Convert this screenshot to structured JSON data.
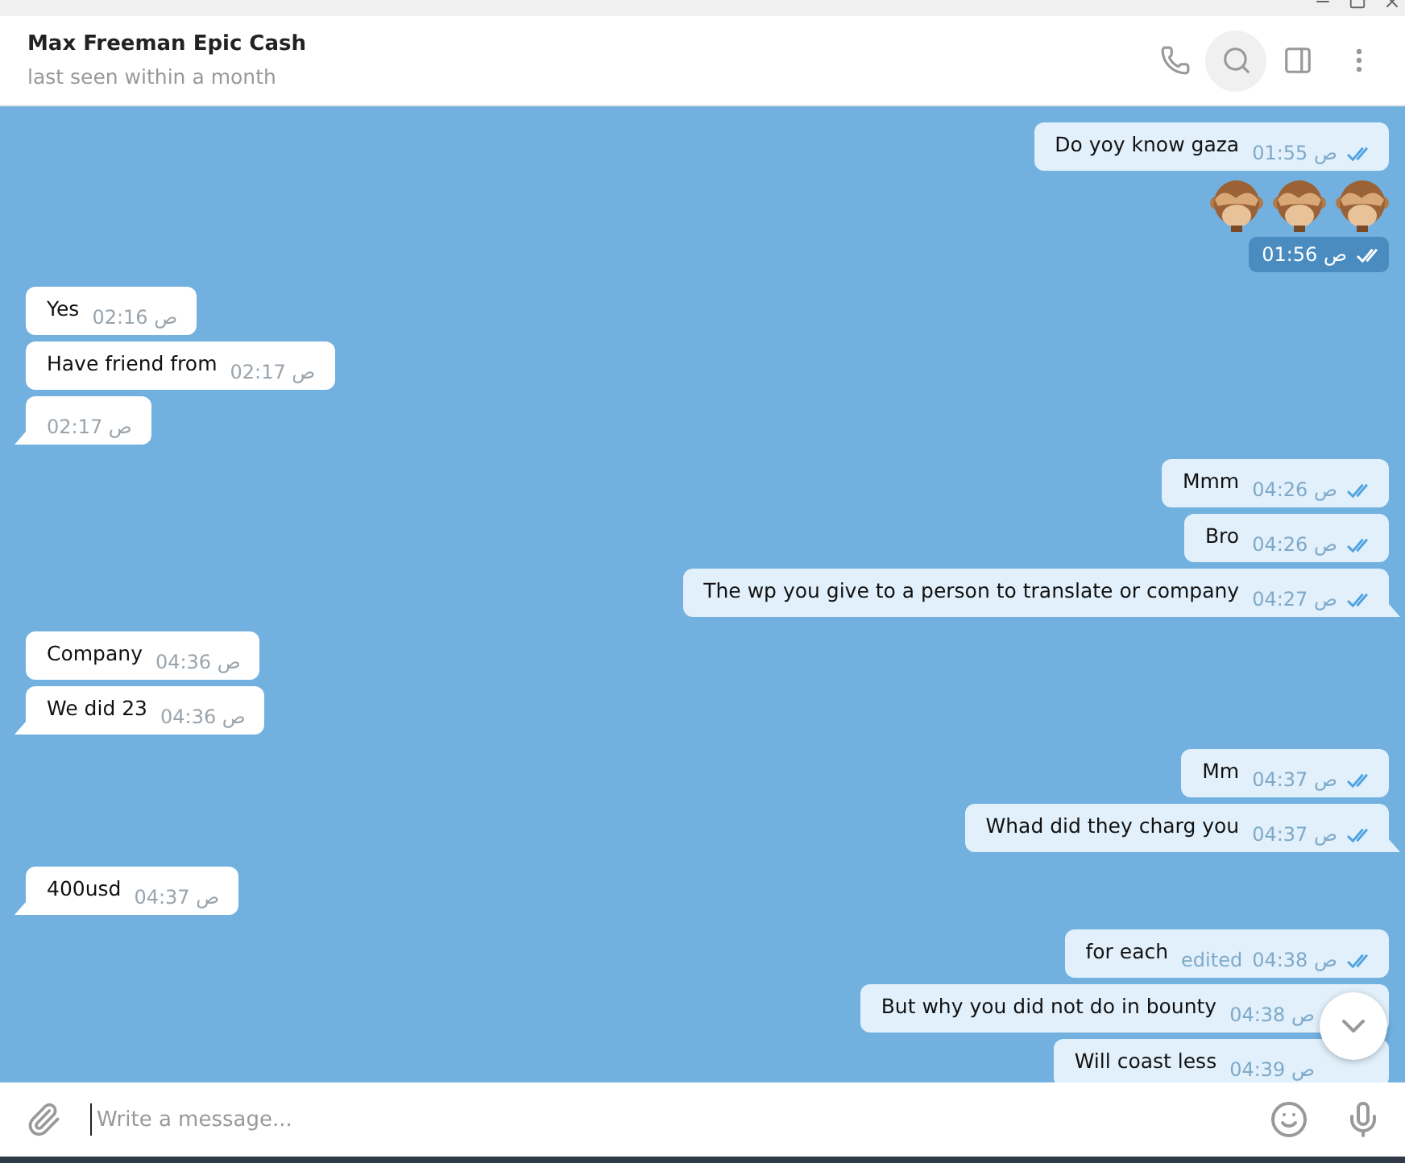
{
  "chat": {
    "title": "Max Freeman Epic Cash",
    "status": "last seen within a month"
  },
  "messages": [
    {
      "kind": "text",
      "outgoing": true,
      "text": "Do yoy know gaza",
      "time": "01:55 ص",
      "read": true
    },
    {
      "kind": "emoji",
      "outgoing": true,
      "emojis": [
        {
          "kind": "see-no-evil-monkey"
        },
        {
          "kind": "see-no-evil-monkey"
        },
        {
          "kind": "see-no-evil-monkey"
        }
      ],
      "time": "01:56 ص",
      "read": true
    },
    {
      "kind": "text",
      "outgoing": false,
      "text": "Yes",
      "time": "02:16 ص",
      "tail": false
    },
    {
      "kind": "text",
      "outgoing": false,
      "text": "Have friend from",
      "time": "02:17 ص",
      "tail": false
    },
    {
      "kind": "text",
      "outgoing": false,
      "time": "02:17 ص",
      "tail": true
    },
    {
      "kind": "text",
      "outgoing": true,
      "text": "Mmm",
      "time": "04:26 ص",
      "read": true,
      "tail": false
    },
    {
      "kind": "text",
      "outgoing": true,
      "text": "Bro",
      "time": "04:26 ص",
      "read": true,
      "tail": false
    },
    {
      "kind": "text",
      "outgoing": true,
      "text": "The wp you give to a person to translate or company",
      "time": "04:27 ص",
      "read": true,
      "tail": true
    },
    {
      "kind": "text",
      "outgoing": false,
      "text": "Company",
      "time": "04:36 ص",
      "tail": false
    },
    {
      "kind": "text",
      "outgoing": false,
      "text": "We did 23",
      "time": "04:36 ص",
      "tail": true
    },
    {
      "kind": "text",
      "outgoing": true,
      "text": "Mm",
      "time": "04:37 ص",
      "read": true,
      "tail": false
    },
    {
      "kind": "text",
      "outgoing": true,
      "text": "Whad did they charg you",
      "time": "04:37 ص",
      "read": true,
      "tail": true
    },
    {
      "kind": "text",
      "outgoing": false,
      "text": "400usd",
      "time": "04:37 ص",
      "tail": true
    },
    {
      "kind": "text",
      "outgoing": true,
      "text": "for each",
      "edited": "edited",
      "time": "04:38 ص",
      "read": true
    },
    {
      "kind": "text",
      "outgoing": true,
      "text": "But why you did not do in bounty",
      "time": "04:38 ص",
      "covered": true
    },
    {
      "kind": "text",
      "outgoing": true,
      "text": "Will coast less",
      "time": "04:39 ص",
      "covered": true
    }
  ],
  "composer": {
    "placeholder": "Write a message..."
  }
}
